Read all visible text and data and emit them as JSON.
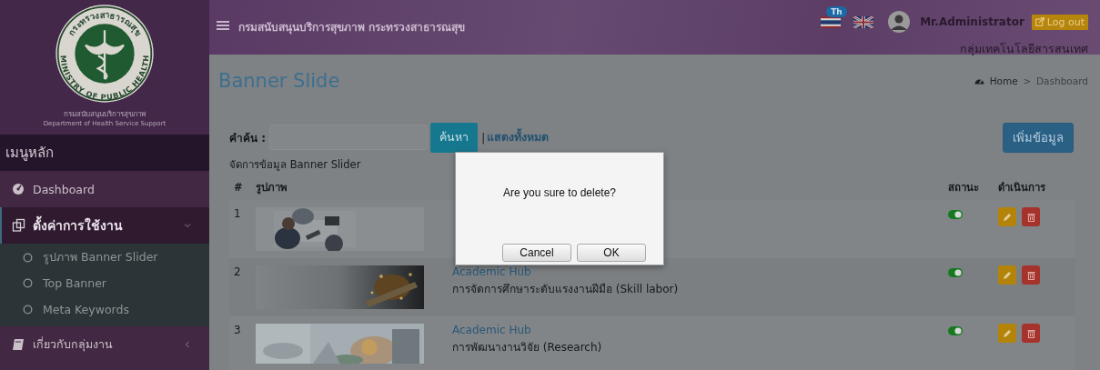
{
  "sidebar": {
    "logo": {
      "seal_top": "กระทรวงสาธารณสุข",
      "seal_bottom": "MINISTRY OF PUBLIC HEALTH",
      "name": "กรมสนับสนุนบริการสุขภาพ",
      "name_en": "Department of Health Service Support"
    },
    "menu_title": "เมนูหลัก",
    "items": [
      {
        "kind": "dashboard",
        "label": "Dashboard",
        "expanded": false
      },
      {
        "kind": "settings",
        "label": "ตั้งค่าการใช้งาน",
        "expanded": true,
        "children": [
          {
            "label": "รูปภาพ Banner Slider"
          },
          {
            "label": "Top Banner"
          },
          {
            "label": "Meta Keywords"
          }
        ]
      },
      {
        "kind": "book",
        "label": "เกี่ยวกับกลุ่มงาน",
        "expanded": false
      }
    ]
  },
  "topbar": {
    "title": "กรมสนับสนุนบริการสุขภาพ กระทรวงสาธารณสุข",
    "languages": [
      {
        "kind": "th",
        "badge": "Th"
      },
      {
        "kind": "uk"
      }
    ],
    "user": "Mr.Administrator",
    "logout": "Log out",
    "department": "กลุ่มเทคโนโลยีสารสนเทศ"
  },
  "page": {
    "title": "Banner Slide",
    "breadcrumb": {
      "items": [
        "Home",
        "Dashboard"
      ],
      "separator": ">"
    },
    "search": {
      "label": "คำค้น :",
      "button": "ค้นหา",
      "divider": "|",
      "show_all": "แสดงทั้งหมด"
    },
    "add_button": "เพิ่มข้อมูล",
    "caption": "จัดการข้อมูล Banner Slider"
  },
  "table": {
    "columns": [
      "#",
      "รูปภาพ",
      null,
      "สถานะ",
      "ดำเนินการ"
    ],
    "rows": [
      {
        "number": "1",
        "on": true
      },
      {
        "number": "2",
        "category": "Academic Hub",
        "title": "การจัดการศึกษาระดับแรงงานฝีมือ (Skill labor)",
        "on": true
      },
      {
        "number": "3",
        "category": "Academic Hub",
        "title": "การพัฒนางานวิจัย (Research)",
        "on": true
      }
    ]
  },
  "dialog": {
    "message": "Are you sure to delete?",
    "buttons": [
      "Cancel",
      "OK"
    ]
  }
}
